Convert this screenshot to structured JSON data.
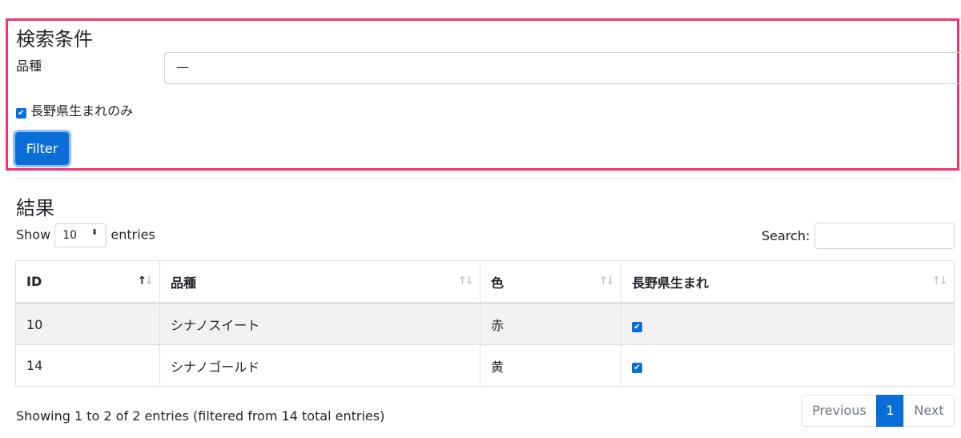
{
  "filter": {
    "title": "検索条件",
    "variety_label": "品種",
    "variety_value": "—",
    "nagano_only_label": "長野県生まれのみ",
    "nagano_only_checked": true,
    "button": "Filter"
  },
  "results": {
    "title": "結果",
    "show_label": "Show",
    "entries_label": "entries",
    "page_length": "10",
    "search_label": "Search:",
    "search_value": "",
    "columns": [
      "ID",
      "品種",
      "色",
      "長野県生まれ"
    ],
    "rows": [
      {
        "id": "10",
        "variety": "シナノスイート",
        "color": "赤",
        "nagano": true
      },
      {
        "id": "14",
        "variety": "シナノゴールド",
        "color": "黄",
        "nagano": true
      }
    ],
    "info": "Showing 1 to 2 of 2 entries (filtered from 14 total entries)",
    "pagination": {
      "previous": "Previous",
      "current": "1",
      "next": "Next"
    }
  },
  "colors": {
    "primary": "#0a6ed8",
    "highlight": "#f5336d"
  }
}
